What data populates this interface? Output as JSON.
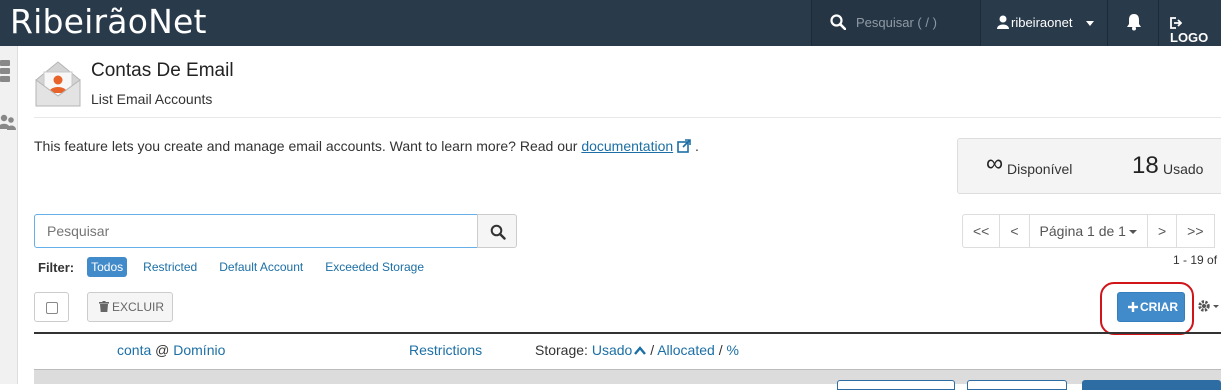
{
  "topbar": {
    "brand": "RibeirãoNet",
    "search_placeholder": "Pesquisar ( / )",
    "username": "ribeiraonet",
    "logout_label": "LOGO"
  },
  "page": {
    "title": "Contas De Email",
    "subtitle": "List Email Accounts",
    "description": "This feature lets you create and manage email accounts. Want to learn more? Read our",
    "doc_link": "documentation",
    "desc_end": "."
  },
  "stats": {
    "available_value": "∞",
    "available_label": "Disponível",
    "used_value": "18",
    "used_label": "Usado"
  },
  "search": {
    "placeholder": "Pesquisar"
  },
  "pagination": {
    "first": "<<",
    "prev": "<",
    "page_label": "Página 1 de 1",
    "next": ">",
    "last": ">>",
    "count": "1 - 19 of"
  },
  "filter": {
    "label": "Filter:",
    "options": [
      "Todos",
      "Restricted",
      "Default Account",
      "Exceeded Storage"
    ],
    "active": "Todos"
  },
  "toolbar": {
    "delete_label": "EXCLUIR",
    "create_label": "CRIAR"
  },
  "table": {
    "col_account": "conta",
    "col_at": "@",
    "col_domain": "Domínio",
    "col_restrictions": "Restrictions",
    "col_storage": "Storage:",
    "col_used": "Usado",
    "col_sep1": "/",
    "col_allocated": "Allocated",
    "col_sep2": "/",
    "col_percent": "%"
  },
  "colors": {
    "topbar": "#293a4a",
    "primary": "#428bca",
    "link": "#1c6fa5",
    "highlight": "#d0141a",
    "accent_icon": "#e8632a"
  }
}
